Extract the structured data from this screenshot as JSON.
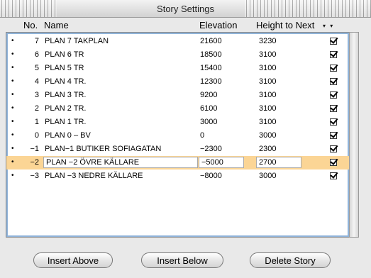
{
  "window": {
    "title": "Story Settings"
  },
  "columns": {
    "no": "No.",
    "name": "Name",
    "elevation": "Elevation",
    "height_to_next": "Height to Next"
  },
  "sort_indicator": "▾ ▾",
  "bullet_glyph": "•",
  "stories": [
    {
      "no": "7",
      "name": "PLAN 7  TAKPLAN",
      "elevation": "21600",
      "height_to_next": "3230",
      "checked": true
    },
    {
      "no": "6",
      "name": "PLAN 6 TR",
      "elevation": "18500",
      "height_to_next": "3100",
      "checked": true
    },
    {
      "no": "5",
      "name": "PLAN 5 TR",
      "elevation": "15400",
      "height_to_next": "3100",
      "checked": true
    },
    {
      "no": "4",
      "name": "PLAN 4 TR.",
      "elevation": "12300",
      "height_to_next": "3100",
      "checked": true
    },
    {
      "no": "3",
      "name": "PLAN 3 TR.",
      "elevation": "9200",
      "height_to_next": "3100",
      "checked": true
    },
    {
      "no": "2",
      "name": "PLAN 2 TR.",
      "elevation": "6100",
      "height_to_next": "3100",
      "checked": true
    },
    {
      "no": "1",
      "name": "PLAN 1 TR.",
      "elevation": "3000",
      "height_to_next": "3100",
      "checked": true
    },
    {
      "no": "0",
      "name": "PLAN 0 – BV",
      "elevation": "0",
      "height_to_next": "3000",
      "checked": true
    },
    {
      "no": "−1",
      "name": "PLAN−1 BUTIKER SOFIAGATAN",
      "elevation": "−2300",
      "height_to_next": "2300",
      "checked": true
    },
    {
      "no": "−2",
      "name": "PLAN −2  ÖVRE KÄLLARE",
      "elevation": "−5000",
      "height_to_next": "2700",
      "checked": true,
      "selected": true
    },
    {
      "no": "−3",
      "name": "PLAN −3  NEDRE KÄLLARE",
      "elevation": "−8000",
      "height_to_next": "3000",
      "checked": true
    }
  ],
  "buttons": {
    "insert_above": "Insert Above",
    "insert_below": "Insert Below",
    "delete_story": "Delete Story"
  }
}
